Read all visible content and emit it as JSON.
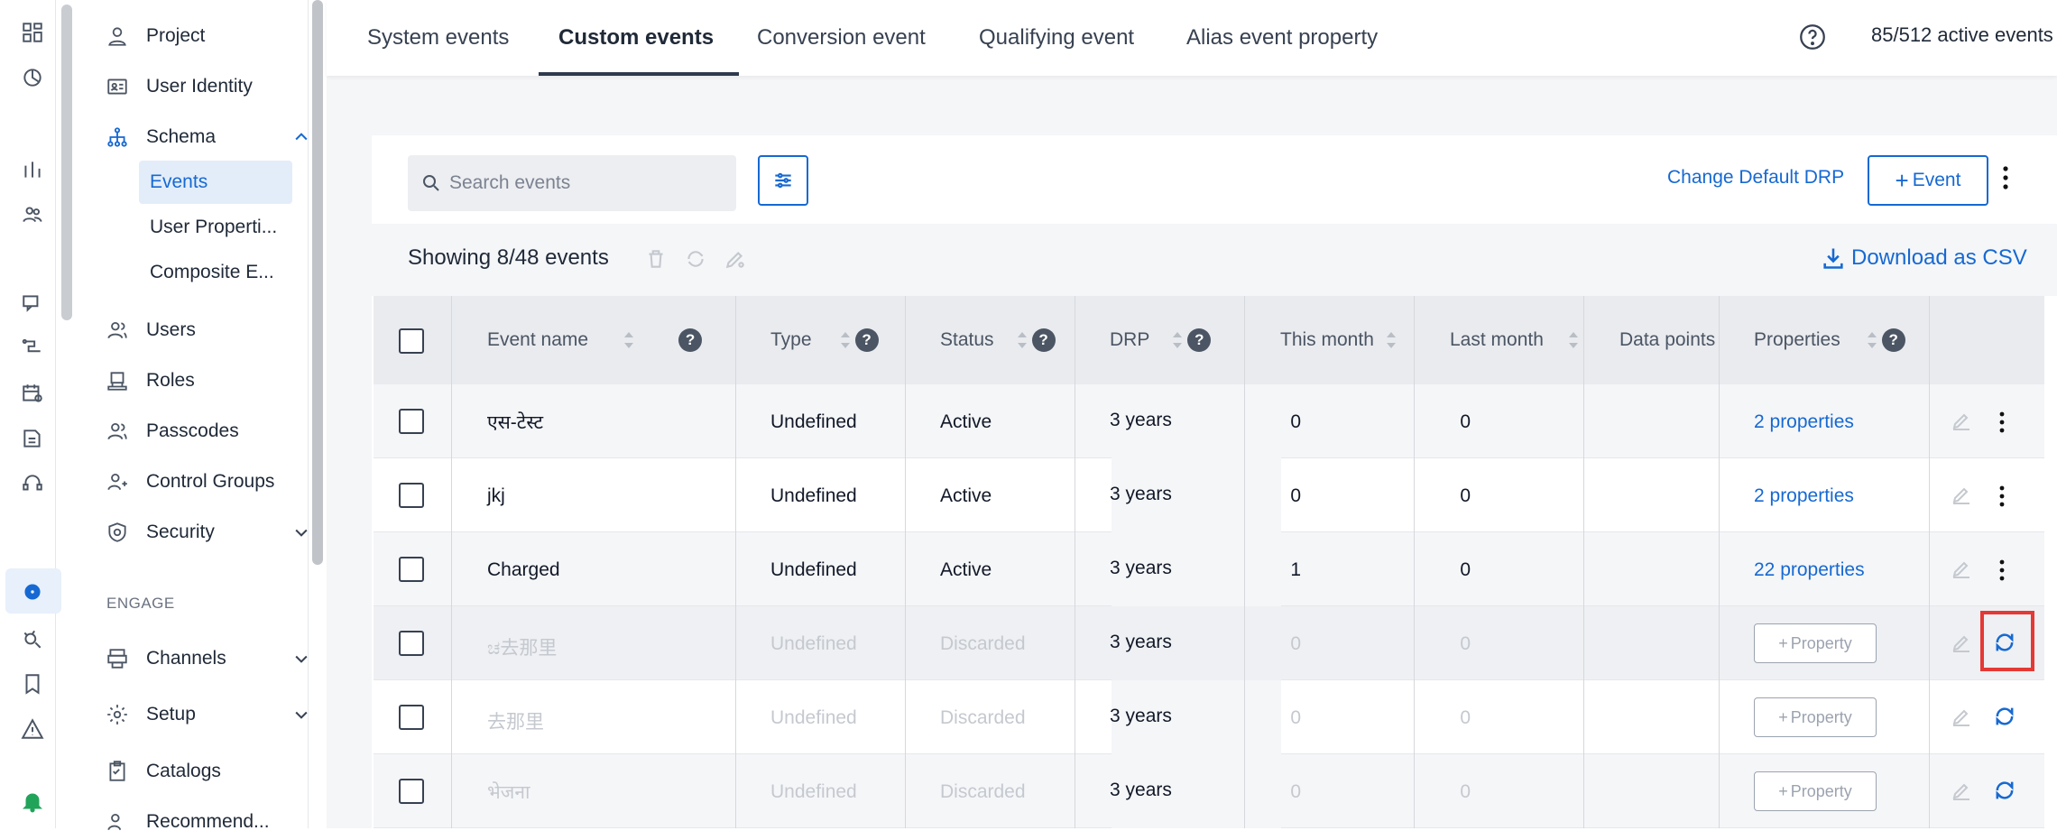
{
  "nav": {
    "items": [
      {
        "label": "Project",
        "icon": "person-icon"
      },
      {
        "label": "User Identity",
        "icon": "id-card-icon"
      },
      {
        "label": "Schema",
        "icon": "schema-icon"
      },
      {
        "label": "Users",
        "icon": "users-icon"
      },
      {
        "label": "Roles",
        "icon": "hat-icon"
      },
      {
        "label": "Passcodes",
        "icon": "passcode-icon"
      },
      {
        "label": "Control Groups",
        "icon": "control-group-icon"
      },
      {
        "label": "Security",
        "icon": "shield-icon"
      },
      {
        "label": "Channels",
        "icon": "channels-icon"
      },
      {
        "label": "Setup",
        "icon": "gear-icon"
      },
      {
        "label": "Catalogs",
        "icon": "catalog-icon"
      },
      {
        "label": "Recommend...",
        "icon": "recommend-icon"
      }
    ],
    "schema_sub": [
      "Events",
      "User Properti...",
      "Composite E..."
    ],
    "section_engage": "ENGAGE"
  },
  "tabs": [
    "System events",
    "Custom events",
    "Conversion event",
    "Qualifying event",
    "Alias event property"
  ],
  "header": {
    "active_count": "85/512 active events"
  },
  "toolbar": {
    "search_placeholder": "Search events",
    "change_drp": "Change Default DRP",
    "add_event": "Event",
    "showing": "Showing 8/48 events",
    "download": "Download as CSV"
  },
  "columns": [
    "Event name",
    "Type",
    "Status",
    "DRP",
    "This month",
    "Last month",
    "Data points",
    "Properties"
  ],
  "rows": [
    {
      "name": "एस-टेस्ट",
      "type": "Undefined",
      "status": "Active",
      "drp": "3 years",
      "this_month": "0",
      "last_month": "0",
      "properties": "2 properties",
      "discarded": false
    },
    {
      "name": "jkj",
      "type": "Undefined",
      "status": "Active",
      "drp": "3 years",
      "this_month": "0",
      "last_month": "0",
      "properties": "2 properties",
      "discarded": false
    },
    {
      "name": "Charged",
      "type": "Undefined",
      "status": "Active",
      "drp": "3 years",
      "this_month": "1",
      "last_month": "0",
      "properties": "22 properties",
      "discarded": false
    },
    {
      "name": "ಚ去那里",
      "type": "Undefined",
      "status": "Discarded",
      "drp": "3 years",
      "this_month": "0",
      "last_month": "0",
      "properties": "Property",
      "discarded": true
    },
    {
      "name": "去那里",
      "type": "Undefined",
      "status": "Discarded",
      "drp": "3 years",
      "this_month": "0",
      "last_month": "0",
      "properties": "Property",
      "discarded": true
    },
    {
      "name": "भेजना",
      "type": "Undefined",
      "status": "Discarded",
      "drp": "3 years",
      "this_month": "0",
      "last_month": "0",
      "properties": "Property",
      "discarded": true
    }
  ],
  "colors": {
    "accent": "#1669d2",
    "highlight": "#e53935",
    "header_bg": "#e9ebef"
  }
}
